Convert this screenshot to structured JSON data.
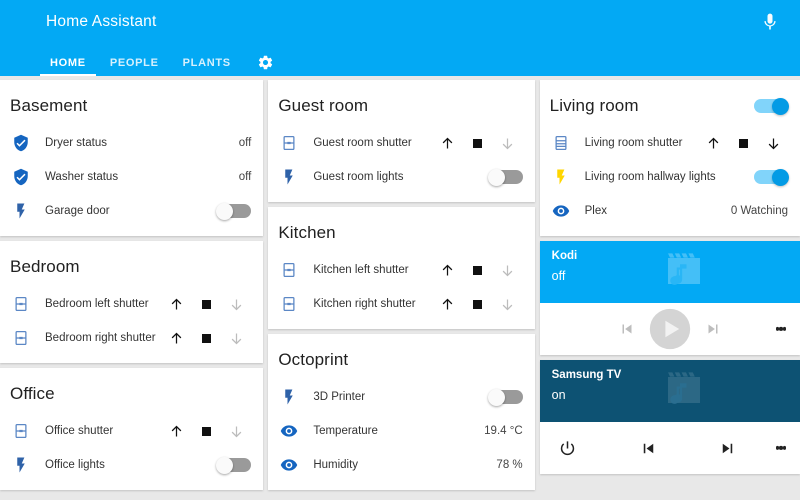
{
  "appbar": {
    "title": "Home Assistant",
    "mic_icon": "microphone-icon",
    "gear_icon": "gear-icon",
    "tabs": [
      {
        "label": "HOME",
        "active": true
      },
      {
        "label": "PEOPLE",
        "active": false
      },
      {
        "label": "PLANTS",
        "active": false
      }
    ]
  },
  "colors": {
    "primary": "#03a9f4",
    "kodi_header": "#03a9f4",
    "tv_header": "#0d5273",
    "toggle_on_track": "#81d4fa",
    "toggle_on_knob": "#039be5",
    "toggle_off_track": "#9a9a9a",
    "shutter_icon": "#5b87c5",
    "bolt_icon": "#2f62a8",
    "bolt_icon_on": "#ffd600",
    "eye_icon": "#1565c0",
    "shield_icon": "#1565c0",
    "background": "#e8e8e8"
  },
  "columns": [
    {
      "cards": [
        {
          "title": "Basement",
          "rows": [
            {
              "icon": "shield-check-icon",
              "label": "Dryer status",
              "value": "off",
              "control": "value"
            },
            {
              "icon": "shield-check-icon",
              "label": "Washer status",
              "value": "off",
              "control": "value"
            },
            {
              "icon": "lightning-bolt-icon",
              "label": "Garage door",
              "control": "toggle",
              "state": "off"
            }
          ]
        },
        {
          "title": "Bedroom",
          "rows": [
            {
              "icon": "shutter-icon",
              "label": "Bedroom left shutter",
              "control": "shutter",
              "up": "enabled",
              "stop": "enabled",
              "down": "disabled"
            },
            {
              "icon": "shutter-icon",
              "label": "Bedroom right shutter",
              "control": "shutter",
              "up": "enabled",
              "stop": "enabled",
              "down": "disabled"
            }
          ]
        },
        {
          "title": "Office",
          "rows": [
            {
              "icon": "shutter-icon",
              "label": "Office shutter",
              "control": "shutter",
              "up": "enabled",
              "stop": "enabled",
              "down": "disabled"
            },
            {
              "icon": "lightning-bolt-icon",
              "label": "Office lights",
              "control": "toggle",
              "state": "off"
            }
          ]
        }
      ]
    },
    {
      "cards": [
        {
          "title": "Guest room",
          "rows": [
            {
              "icon": "shutter-icon",
              "label": "Guest room shutter",
              "control": "shutter",
              "up": "enabled",
              "stop": "enabled",
              "down": "disabled"
            },
            {
              "icon": "lightning-bolt-icon",
              "label": "Guest room lights",
              "control": "toggle",
              "state": "off"
            }
          ]
        },
        {
          "title": "Kitchen",
          "rows": [
            {
              "icon": "shutter-icon",
              "label": "Kitchen left shutter",
              "control": "shutter",
              "up": "enabled",
              "stop": "enabled",
              "down": "disabled"
            },
            {
              "icon": "shutter-icon",
              "label": "Kitchen right shutter",
              "control": "shutter",
              "up": "enabled",
              "stop": "enabled",
              "down": "disabled"
            }
          ]
        },
        {
          "title": "Octoprint",
          "rows": [
            {
              "icon": "lightning-bolt-icon",
              "label": "3D Printer",
              "control": "toggle",
              "state": "off"
            },
            {
              "icon": "eye-icon",
              "label": "Temperature",
              "value": "19.4 °C",
              "control": "value"
            },
            {
              "icon": "eye-icon",
              "label": "Humidity",
              "value": "78 %",
              "control": "value"
            }
          ]
        }
      ]
    },
    {
      "cards": [
        {
          "title": "Living room",
          "header_toggle": "on",
          "rows": [
            {
              "icon": "shutter-icon",
              "label": "Living room shutter",
              "control": "shutter",
              "up": "enabled",
              "stop": "enabled",
              "down": "enabled"
            },
            {
              "icon": "lightning-bolt-icon-on",
              "label": "Living room hallway lights",
              "control": "toggle",
              "state": "on"
            },
            {
              "icon": "eye-icon",
              "label": "Plex",
              "value": "0 Watching",
              "control": "value"
            }
          ]
        }
      ],
      "media": [
        {
          "name": "Kodi",
          "state": "off",
          "header_color": "#03a9f4",
          "watermark": "movie-music-icon",
          "controls": [
            "previous-icon",
            "play-icon",
            "next-icon",
            "more-vert-icon"
          ]
        },
        {
          "name": "Samsung TV",
          "state": "on",
          "header_color": "#0d5273",
          "watermark": "movie-music-icon",
          "controls": [
            "power-icon",
            "previous-icon",
            "next-icon",
            "more-vert-icon"
          ]
        }
      ]
    }
  ]
}
